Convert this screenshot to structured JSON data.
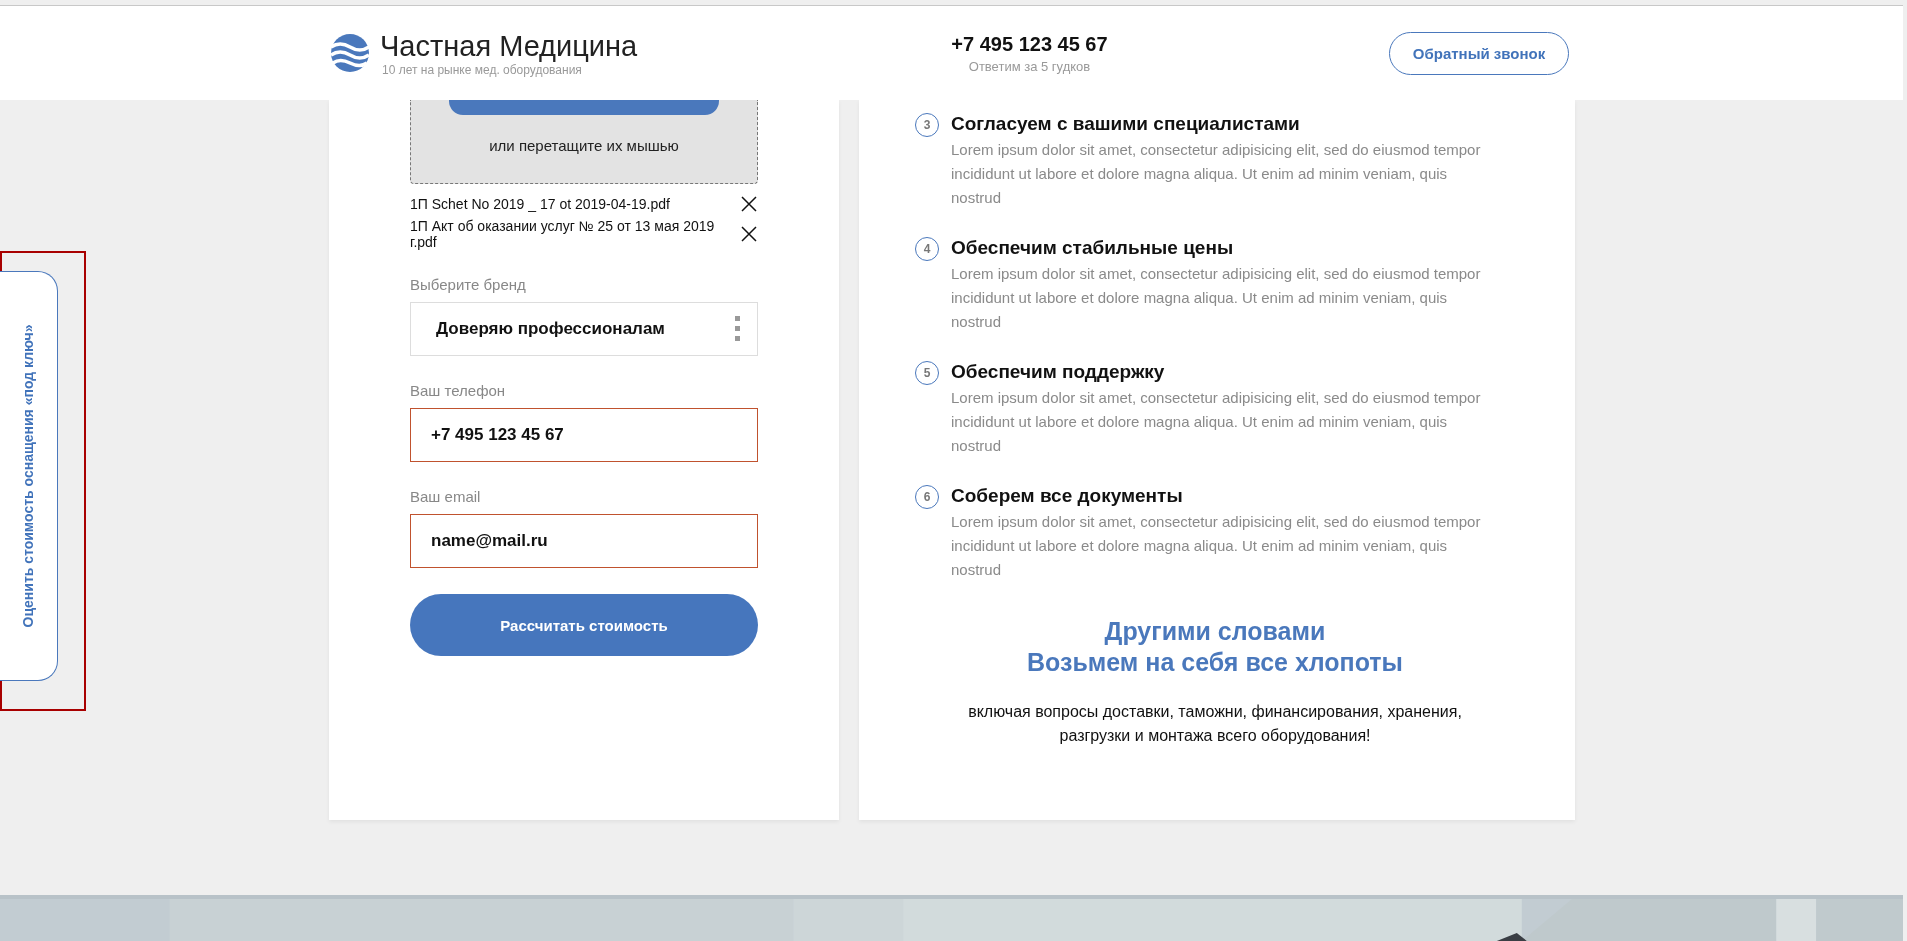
{
  "header": {
    "logo_title": "Частная Медицина",
    "logo_subtitle": "10 лет на рынке мед. оборудования",
    "phone": "+7 495 123 45 67",
    "phone_note": "Ответим за 5 гудков",
    "callback_button": "Обратный звонок"
  },
  "side_tab": {
    "label": "Оценить стоимость оснащения «под ключ»",
    "highlighted": true
  },
  "upload": {
    "hint": "или перетащите их мышью",
    "files": [
      {
        "name": "1П Schet No 2019 _ 17 ot 2019-04-19.pdf"
      },
      {
        "name": "1П Акт об оказании услуг № 25 от 13 мая 2019 г.pdf"
      }
    ]
  },
  "fields": [
    {
      "kind": "select",
      "label": "Выберите бренд",
      "value": "Доверяю профессионалам",
      "invalid": false
    },
    {
      "kind": "input",
      "label": "Ваш телефон",
      "value": "+7 495 123 45 67",
      "invalid": true
    },
    {
      "kind": "input",
      "label": "Ваш email",
      "value": "name@mail.ru",
      "invalid": true
    }
  ],
  "submit_button": "Рассчитать стоимость",
  "steps": [
    {
      "number": "3",
      "title": "Согласуем с вашими специалистами",
      "text": "Lorem ipsum dolor sit amet, consectetur adipisicing elit, sed do eiusmod tempor incididunt ut labore et dolore magna aliqua. Ut enim ad minim veniam, quis nostrud"
    },
    {
      "number": "4",
      "title": "Обеспечим стабильные цены",
      "text": "Lorem ipsum dolor sit amet, consectetur adipisicing elit, sed do eiusmod tempor incididunt ut labore et dolore magna aliqua. Ut enim ad minim veniam, quis nostrud"
    },
    {
      "number": "5",
      "title": "Обеспечим поддержку",
      "text": "Lorem ipsum dolor sit amet, consectetur adipisicing elit, sed do eiusmod tempor incididunt ut labore et dolore magna aliqua. Ut enim ad minim veniam, quis nostrud"
    },
    {
      "number": "6",
      "title": "Соберем все документы",
      "text": "Lorem ipsum dolor sit amet, consectetur adipisicing elit, sed do eiusmod tempor incididunt ut labore et dolore magna aliqua. Ut enim ad minim veniam, quis nostrud"
    }
  ],
  "summary": {
    "title_lines": [
      "Другими словами",
      "Возьмем на себя все хлопоты"
    ],
    "text": "включая вопросы доставки, таможни, финансирования, хранения, разгрузки и монтажа всего оборудования!"
  }
}
